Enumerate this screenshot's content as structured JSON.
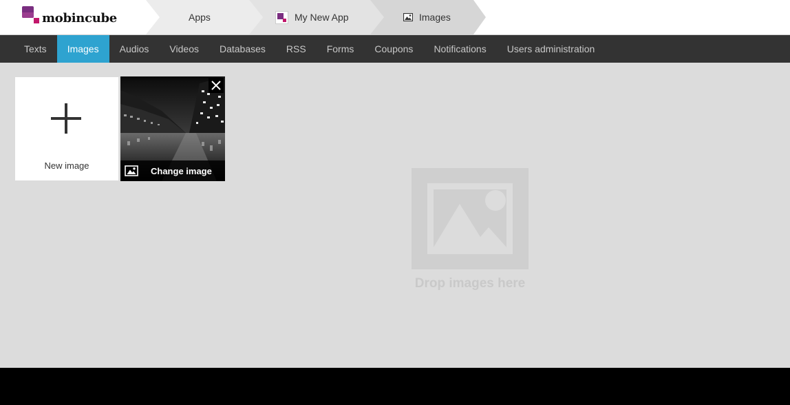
{
  "brand": {
    "name": "mobincube"
  },
  "breadcrumbs": {
    "apps": "Apps",
    "app": "My New App",
    "section": "Images"
  },
  "nav": {
    "items": [
      {
        "label": "Texts",
        "active": false
      },
      {
        "label": "Images",
        "active": true
      },
      {
        "label": "Audios",
        "active": false
      },
      {
        "label": "Videos",
        "active": false
      },
      {
        "label": "Databases",
        "active": false
      },
      {
        "label": "RSS",
        "active": false
      },
      {
        "label": "Forms",
        "active": false
      },
      {
        "label": "Coupons",
        "active": false
      },
      {
        "label": "Notifications",
        "active": false
      },
      {
        "label": "Users administration",
        "active": false
      }
    ]
  },
  "gallery": {
    "new_tile_label": "New image",
    "change_label": "Change image"
  },
  "dropzone": {
    "text": "Drop images here"
  },
  "colors": {
    "nav_bg": "#333333",
    "nav_active": "#2ea3d0",
    "content_bg": "#dcdcdc",
    "brand_purple": "#7a2e80",
    "brand_pink": "#c2176b"
  },
  "icons": {
    "close": "close-icon",
    "image": "image-icon",
    "plus": "plus-icon"
  }
}
